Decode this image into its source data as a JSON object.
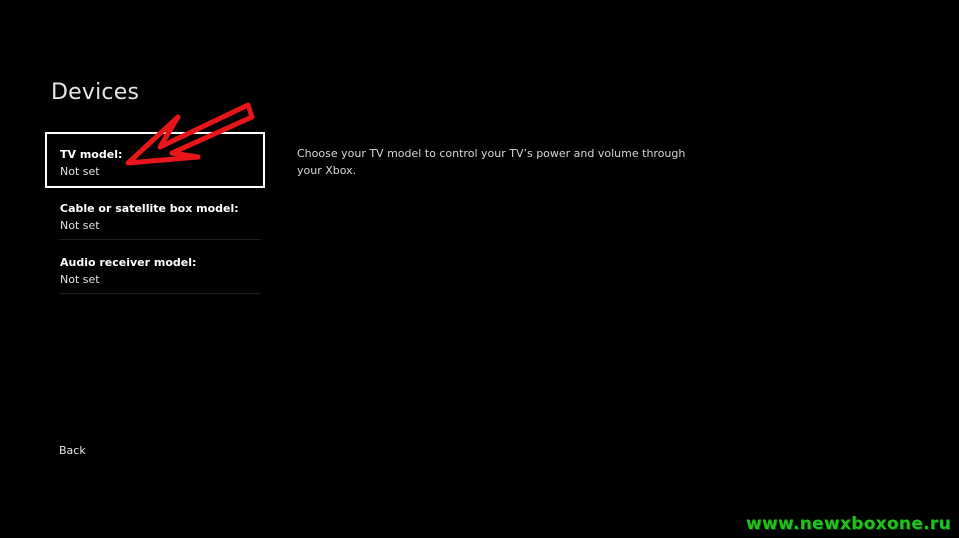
{
  "page": {
    "title": "Devices"
  },
  "menu": {
    "items": [
      {
        "label": "TV model:",
        "value": "Not set",
        "selected": true
      },
      {
        "label": "Cable or satellite box model:",
        "value": "Not set",
        "selected": false
      },
      {
        "label": "Audio receiver model:",
        "value": "Not set",
        "selected": false
      }
    ]
  },
  "description": {
    "text": "Choose your TV model to control your TV’s power and volume through your Xbox."
  },
  "back": {
    "label": "Back"
  },
  "annotation": {
    "arrow_color": "#e8161b"
  },
  "watermark": {
    "text": "www.newxboxone.ru",
    "color": "#22c21e"
  },
  "colors": {
    "background": "#000000",
    "focus_border": "#ffffff",
    "text": "#ffffff"
  }
}
